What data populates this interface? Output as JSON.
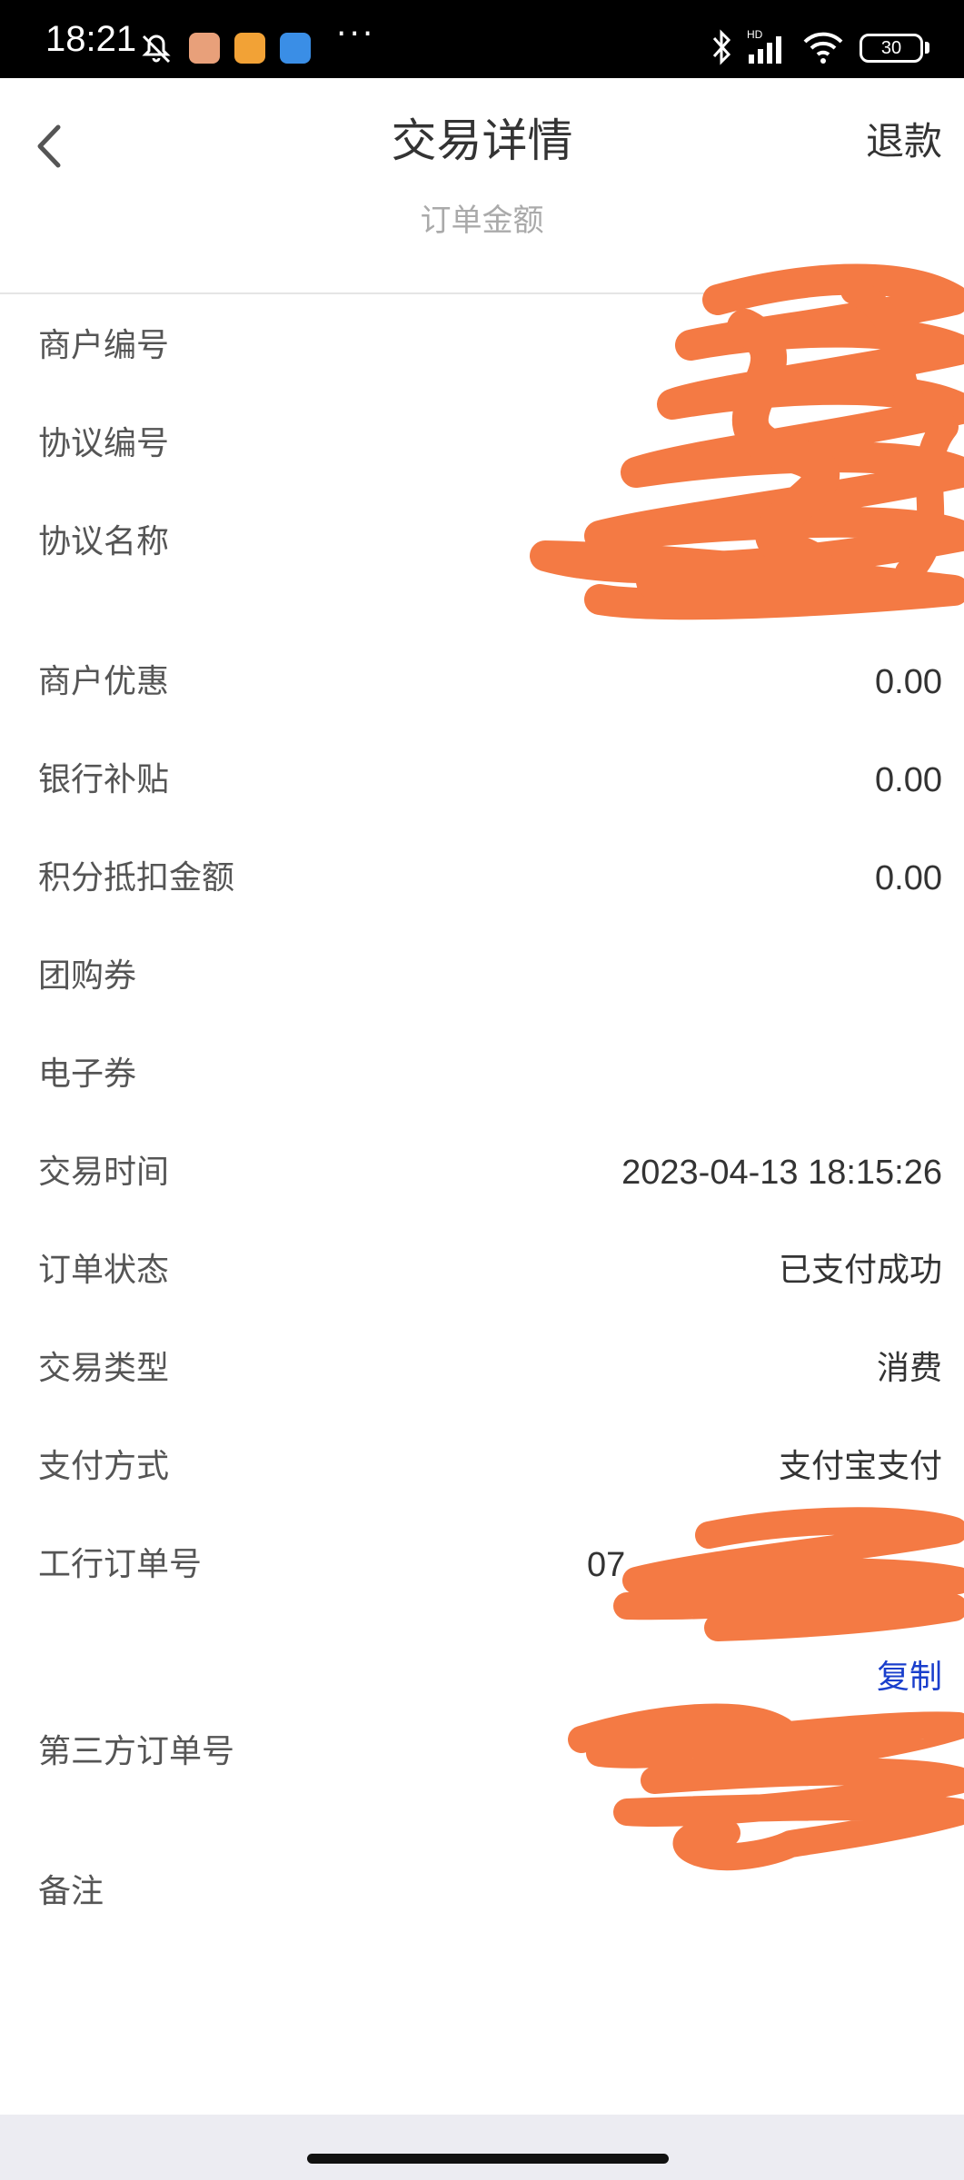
{
  "status_bar": {
    "time": "18:21",
    "battery": "30",
    "more": "···"
  },
  "header": {
    "title": "交易详情",
    "refund_label": "退款",
    "subtitle": "订单金额"
  },
  "rows": {
    "merchant_no": {
      "label": "商户编号"
    },
    "agreement_no": {
      "label": "协议编号"
    },
    "agreement_name": {
      "label": "协议名称"
    },
    "merchant_discount": {
      "label": "商户优惠",
      "value": "0.00"
    },
    "bank_subsidy": {
      "label": "银行补贴",
      "value": "0.00"
    },
    "points_deduction": {
      "label": "积分抵扣金额",
      "value": "0.00"
    },
    "group_coupon": {
      "label": "团购券"
    },
    "e_coupon": {
      "label": "电子券"
    },
    "trade_time": {
      "label": "交易时间",
      "value": "2023-04-13 18:15:26"
    },
    "order_status": {
      "label": "订单状态",
      "value": "已支付成功"
    },
    "trade_type": {
      "label": "交易类型",
      "value": "消费"
    },
    "pay_method": {
      "label": "支付方式",
      "value": "支付宝支付"
    },
    "icbc_order_no": {
      "label": "工行订单号",
      "partial": "07",
      "copy_label": "复制"
    },
    "third_party_order_no": {
      "label": "第三方订单号"
    },
    "remark": {
      "label": "备注"
    }
  },
  "colors": {
    "redaction": "#f47a44",
    "link": "#1a3fcc",
    "label": "#555555"
  }
}
